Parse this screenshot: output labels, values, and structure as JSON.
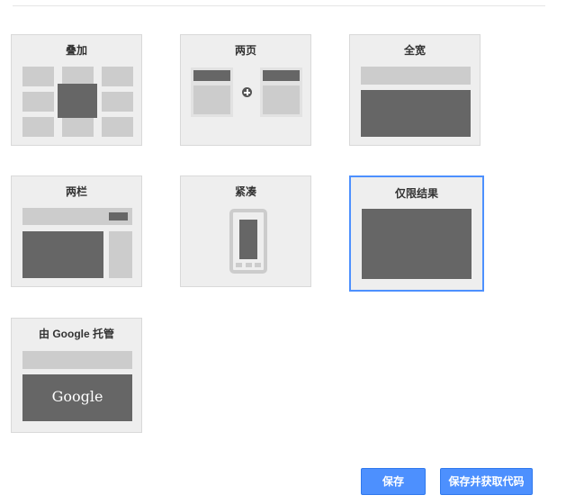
{
  "layouts": {
    "overlay": {
      "label": "叠加"
    },
    "two_page": {
      "label": "两页"
    },
    "full_width": {
      "label": "全宽"
    },
    "two_column": {
      "label": "两栏"
    },
    "compact": {
      "label": "紧凑"
    },
    "results_only": {
      "label": "仅限结果",
      "selected": true
    },
    "google_hosted": {
      "label": "由 Google 托管",
      "logo_text": "Google"
    }
  },
  "buttons": {
    "save": "保存",
    "save_and_get_code": "保存并获取代码"
  },
  "colors": {
    "card_bg": "#eeeeee",
    "block_light": "#cccccc",
    "block_dark": "#666666",
    "selected_border": "#4d90fe",
    "button_bg": "#4d90fe"
  }
}
